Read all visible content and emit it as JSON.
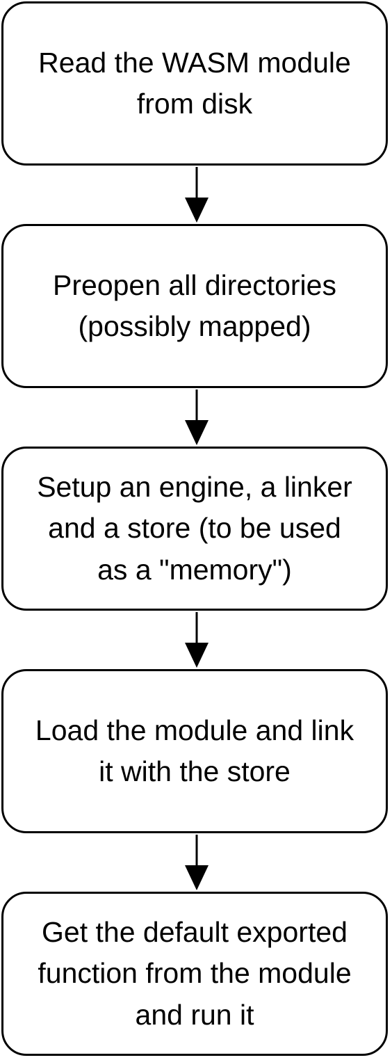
{
  "steps": [
    {
      "label": "Read the WASM module\nfrom disk"
    },
    {
      "label": "Preopen all directories\n(possibly mapped)"
    },
    {
      "label": "Setup an engine, a linker\nand a store (to be used\nas a \"memory\")"
    },
    {
      "label": "Load the module and link\nit with the store"
    },
    {
      "label": "Get the default exported\nfunction from the module\nand run it"
    }
  ]
}
